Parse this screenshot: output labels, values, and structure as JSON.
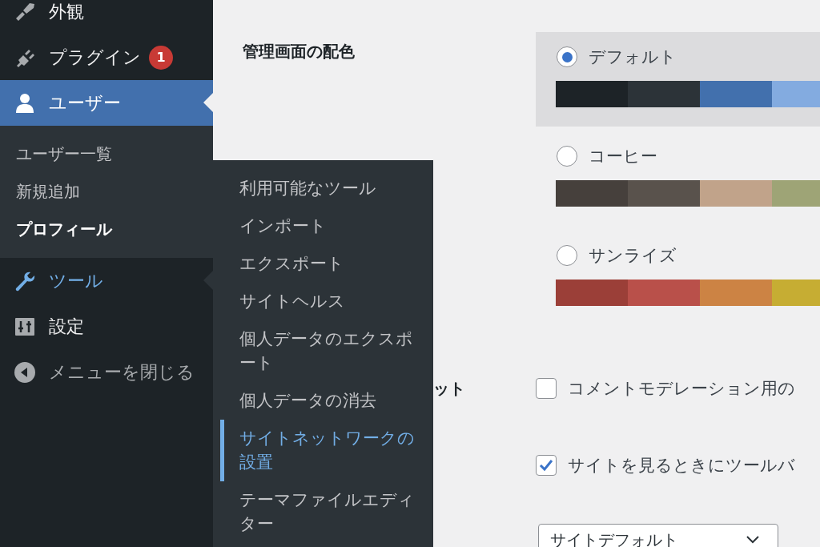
{
  "sidebar": {
    "items": [
      {
        "label": "外観",
        "kind": "menu",
        "selected": false,
        "expanded": false
      },
      {
        "label": "プラグイン",
        "kind": "menu",
        "badge": "1",
        "selected": false,
        "expanded": false
      },
      {
        "label": "ユーザー",
        "kind": "menu",
        "selected": true,
        "expanded": false,
        "submenu": [
          {
            "label": "ユーザー一覧",
            "selected": false
          },
          {
            "label": "新規追加",
            "selected": false
          },
          {
            "label": "プロフィール",
            "selected": true
          }
        ]
      },
      {
        "label": "ツール",
        "kind": "menu",
        "selected": false,
        "expanded": true
      },
      {
        "label": "設定",
        "kind": "menu",
        "selected": false,
        "expanded": false
      },
      {
        "label": "メニューを閉じる",
        "kind": "collapse",
        "selected": false,
        "expanded": false
      }
    ]
  },
  "flyout": {
    "items": [
      {
        "label": "利用可能なツール",
        "selected": false
      },
      {
        "label": "インポート",
        "selected": false
      },
      {
        "label": "エクスポート",
        "selected": false
      },
      {
        "label": "サイトヘルス",
        "selected": false
      },
      {
        "label": "個人データのエクスポート",
        "selected": false
      },
      {
        "label": "個人データの消去",
        "selected": false
      },
      {
        "label": "サイトネットワークの設置",
        "selected": true
      },
      {
        "label": "テーマファイルエディター",
        "selected": false
      }
    ]
  },
  "main": {
    "color_scheme": {
      "label": "管理画面の配色",
      "options": [
        {
          "label": "デフォルト",
          "selected": true,
          "swatches": [
            {
              "color": "#1d2327"
            },
            {
              "color": "#2c3338"
            },
            {
              "color": "#4270ad"
            },
            {
              "color": "#83abe0"
            }
          ]
        },
        {
          "label": "コーヒー",
          "selected": false,
          "swatches": [
            {
              "color": "#46403c"
            },
            {
              "color": "#59524c"
            },
            {
              "color": "#c1a38a"
            },
            {
              "color": "#9ea476"
            }
          ]
        },
        {
          "label": "サンライズ",
          "selected": false,
          "swatches": [
            {
              "color": "#9b3f38"
            },
            {
              "color": "#b9504a"
            },
            {
              "color": "#cc8344"
            },
            {
              "color": "#c6ad33"
            }
          ]
        }
      ]
    },
    "keyboard_shortcuts": {
      "label": "ット",
      "checkbox": {
        "label": "コメントモデレーション用の",
        "checked": false
      }
    },
    "toolbar": {
      "checkbox": {
        "label": "サイトを見るときにツールバ",
        "checked": true
      }
    },
    "language": {
      "value": "サイトデフォルト"
    }
  }
}
